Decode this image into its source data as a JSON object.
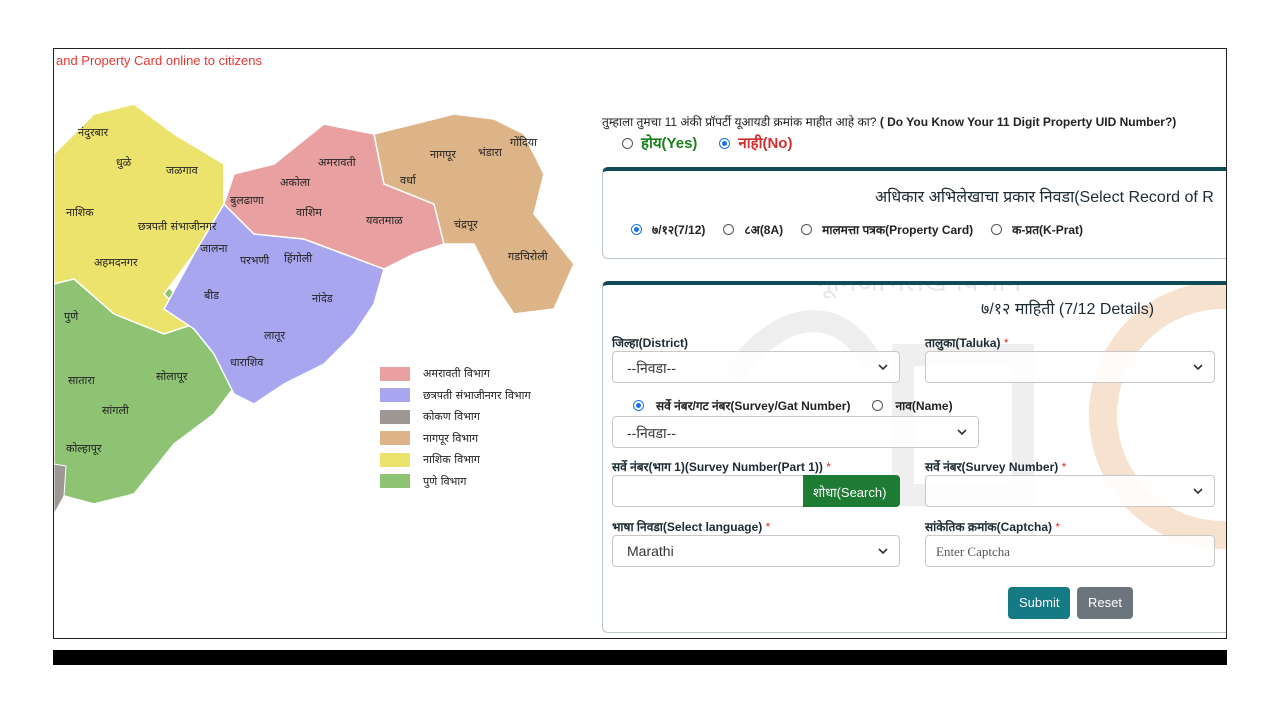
{
  "marquee": "and Property Card online to citizens",
  "uid_question": {
    "text": "तुम्हाला तुमचा 11 अंकी प्रॉपर्टी यूआयडी क्रमांक माहीत आहे का?",
    "text_en": "( Do You Know Your 11 Digit Property UID Number?)",
    "yes_label": "होय(Yes)",
    "no_label": "नाही(No)",
    "selected": "no"
  },
  "record_panel": {
    "title": "अधिकार अभिलेखाचा प्रकार निवडा(Select Record of R",
    "options": [
      {
        "label": "७/१२(7/12)",
        "checked": true
      },
      {
        "label": "८अ(8A)",
        "checked": false
      },
      {
        "label": "मालमत्ता पत्रक(Property Card)",
        "checked": false
      },
      {
        "label": "क-प्रत(K-Prat)",
        "checked": false
      }
    ]
  },
  "details_panel": {
    "watermark_text": "भूमिअभिलेख विभाग",
    "title": "७/१२ माहिती (7/12 Details)",
    "district_label": "जिल्हा(District)",
    "district_value": "--निवडा--",
    "taluka_label": "तालुका(Taluka)",
    "taluka_value": "",
    "search_by_options": [
      {
        "label": "सर्वे नंबर/गट नंबर(Survey/Gat Number)",
        "checked": true
      },
      {
        "label": "नाव(Name)",
        "checked": false
      }
    ],
    "village_value": "--निवडा--",
    "survey_part1_label": "सर्वे नंबर(भाग 1)(Survey Number(Part 1))",
    "survey_part1_value": "",
    "search_button": "शोधा(Search)",
    "survey_number_label": "सर्वे नंबर(Survey Number)",
    "survey_number_value": "",
    "language_label": "भाषा निवडा(Select language)",
    "language_value": "Marathi",
    "captcha_label": "सांकेतिक क्रमांक(Captcha)",
    "captcha_placeholder": "Enter Captcha",
    "required_mark": "*",
    "submit_button": "Submit",
    "reset_button": "Reset"
  },
  "map": {
    "district_labels": [
      "नंदुरबार",
      "धुळे",
      "जळगाव",
      "नाशिक",
      "छत्रपती संभाजीनगर",
      "अहमदनगर",
      "पुणे",
      "सातारा",
      "सांगली",
      "कोल्हापूर",
      "सोलापूर",
      "बीड",
      "जालना",
      "परभणी",
      "हिंगोली",
      "लातूर",
      "धाराशिव",
      "नांदेड",
      "बुलढाणा",
      "अकोला",
      "वाशिम",
      "अमरावती",
      "यवतमाळ",
      "वर्धा",
      "नागपूर",
      "भंडारा",
      "गोंदिया",
      "चंद्रपूर",
      "गडचिरोली"
    ],
    "legend": [
      {
        "label": "अमरावती विभाग",
        "color": "#e8a0a0"
      },
      {
        "label": "छत्रपती संभाजीनगर विभाग",
        "color": "#a7a6ee"
      },
      {
        "label": "कोकण विभाग",
        "color": "#9e9793"
      },
      {
        "label": "नागपूर विभाग",
        "color": "#dcb488"
      },
      {
        "label": "नाशिक विभाग",
        "color": "#ece36d"
      },
      {
        "label": "पुणे विभाग",
        "color": "#8ec374"
      }
    ]
  }
}
